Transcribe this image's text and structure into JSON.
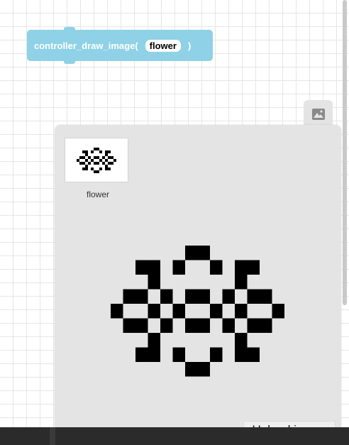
{
  "block": {
    "function_label": "controller_draw_image(",
    "field_value": "flower",
    "close_paren": ")"
  },
  "panel": {
    "tab_icon": "image-icon",
    "images": [
      {
        "label": "flower",
        "icon": "flower-pixel-icon"
      }
    ],
    "upload_label": "Upload image"
  },
  "pixel_art": {
    "pattern": [
      "00000011000000",
      "00110100101100",
      "00010000001000",
      "01101011010110",
      "10010100101001",
      "01101011010110",
      "00010000001000",
      "00110100101100",
      "00000011000000"
    ]
  },
  "colors": {
    "block": "#8fd1e6",
    "panel": "#e4e4e4",
    "pixel": "#000000"
  }
}
